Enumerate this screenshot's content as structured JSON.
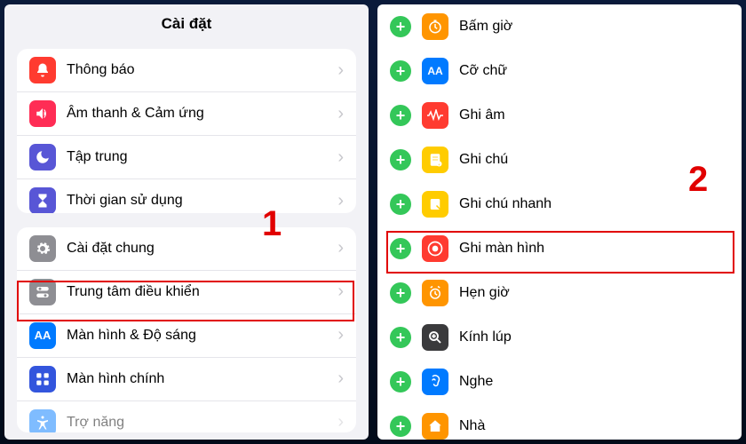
{
  "left": {
    "title": "Cài đặt",
    "groups": [
      [
        {
          "icon": "bell",
          "color": "#ff3b30",
          "label": "Thông báo"
        },
        {
          "icon": "sound",
          "color": "#ff2d55",
          "label": "Âm thanh & Cảm ứng"
        },
        {
          "icon": "moon",
          "color": "#5856d6",
          "label": "Tập trung"
        },
        {
          "icon": "hourglass",
          "color": "#5856d6",
          "label": "Thời gian sử dụng"
        }
      ],
      [
        {
          "icon": "gear",
          "color": "#8e8e93",
          "label": "Cài đặt chung"
        },
        {
          "icon": "switches",
          "color": "#8e8e93",
          "label": "Trung tâm điều khiển"
        },
        {
          "icon": "aa",
          "color": "#007aff",
          "label": "Màn hình & Độ sáng"
        },
        {
          "icon": "grid",
          "color": "#3355dd",
          "label": "Màn hình chính"
        },
        {
          "icon": "acc",
          "color": "#007aff",
          "label": "Trợ năng"
        }
      ]
    ],
    "annotation": "1"
  },
  "right": {
    "items": [
      {
        "icon": "stopwatch",
        "color": "#ff9500",
        "label": "Bấm giờ"
      },
      {
        "icon": "aa",
        "color": "#007aff",
        "label": "Cỡ chữ"
      },
      {
        "icon": "wave",
        "color": "#ff3b30",
        "label": "Ghi âm"
      },
      {
        "icon": "note",
        "color": "#ffcc00",
        "label": "Ghi chú"
      },
      {
        "icon": "quicknote",
        "color": "#ffcc00",
        "label": "Ghi chú nhanh"
      },
      {
        "icon": "record",
        "color": "#ff3b30",
        "label": "Ghi màn hình"
      },
      {
        "icon": "alarm",
        "color": "#ff9500",
        "label": "Hẹn giờ"
      },
      {
        "icon": "magnify",
        "color": "#3a3a3c",
        "label": "Kính lúp"
      },
      {
        "icon": "ear",
        "color": "#007aff",
        "label": "Nghe"
      },
      {
        "icon": "home",
        "color": "#ff9500",
        "label": "Nhà"
      }
    ],
    "annotation": "2"
  },
  "icons": {
    "chevron": "›",
    "plus": "+"
  }
}
